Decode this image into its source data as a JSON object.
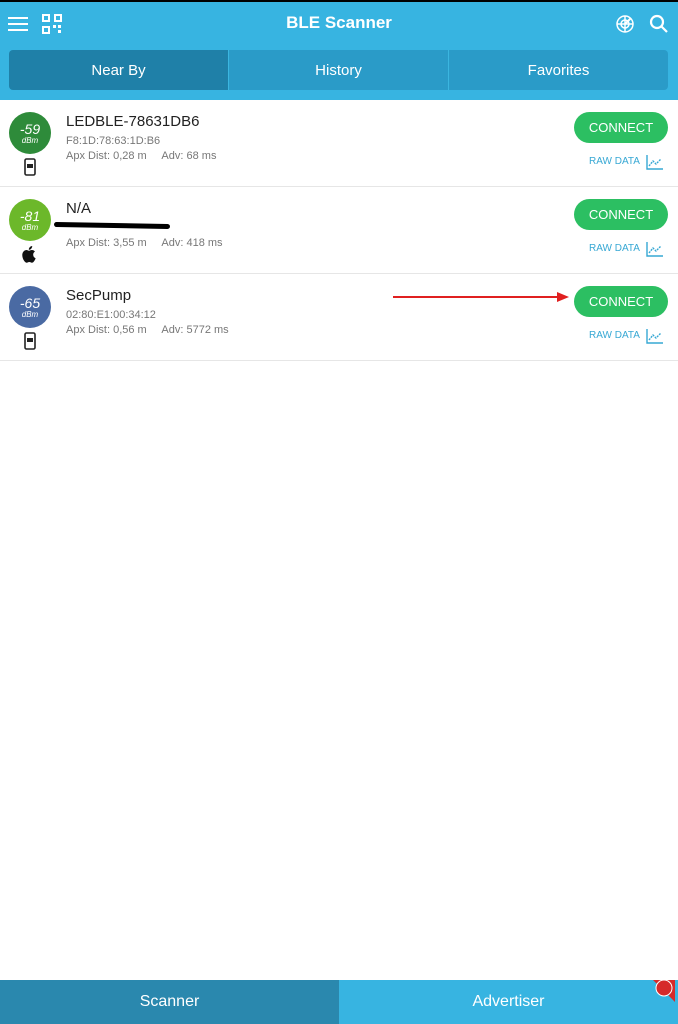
{
  "app": {
    "title": "BLE Scanner"
  },
  "header": {
    "menu_icon": "hamburger-menu-icon",
    "qr_icon": "qr-code-icon",
    "radar_icon": "radar-icon",
    "search_icon": "search-icon"
  },
  "tabs": [
    {
      "label": "Near By",
      "active": true
    },
    {
      "label": "History",
      "active": false
    },
    {
      "label": "Favorites",
      "active": false
    }
  ],
  "devices": [
    {
      "rssi": "-59",
      "unit": "dBm",
      "color": "#2e8b3a",
      "device_icon": "phone-icon",
      "name": "LEDBLE-78631DB6",
      "mac": "F8:1D:78:63:1D:B6",
      "dist_label": "Apx Dist:",
      "dist": "0,28 m",
      "adv_label": "Adv:",
      "adv": "68 ms",
      "connect_label": "CONNECT",
      "raw_label": "RAW DATA"
    },
    {
      "rssi": "-81",
      "unit": "dBm",
      "color": "#6cb82a",
      "device_icon": "apple-icon",
      "name": "N/A",
      "mac": "",
      "dist_label": "Apx Dist:",
      "dist": "3,55 m",
      "adv_label": "Adv:",
      "adv": "418 ms",
      "connect_label": "CONNECT",
      "raw_label": "RAW DATA"
    },
    {
      "rssi": "-65",
      "unit": "dBm",
      "color": "#4a6aa3",
      "device_icon": "phone-icon",
      "name": "SecPump",
      "mac": "02:80:E1:00:34:12",
      "dist_label": "Apx Dist:",
      "dist": "0,56 m",
      "adv_label": "Adv:",
      "adv": "5772 ms",
      "connect_label": "CONNECT",
      "raw_label": "RAW DATA"
    }
  ],
  "bottom_tabs": [
    {
      "label": "Scanner"
    },
    {
      "label": "Advertiser"
    }
  ],
  "annotation": {
    "arrow_color": "#e02020"
  }
}
